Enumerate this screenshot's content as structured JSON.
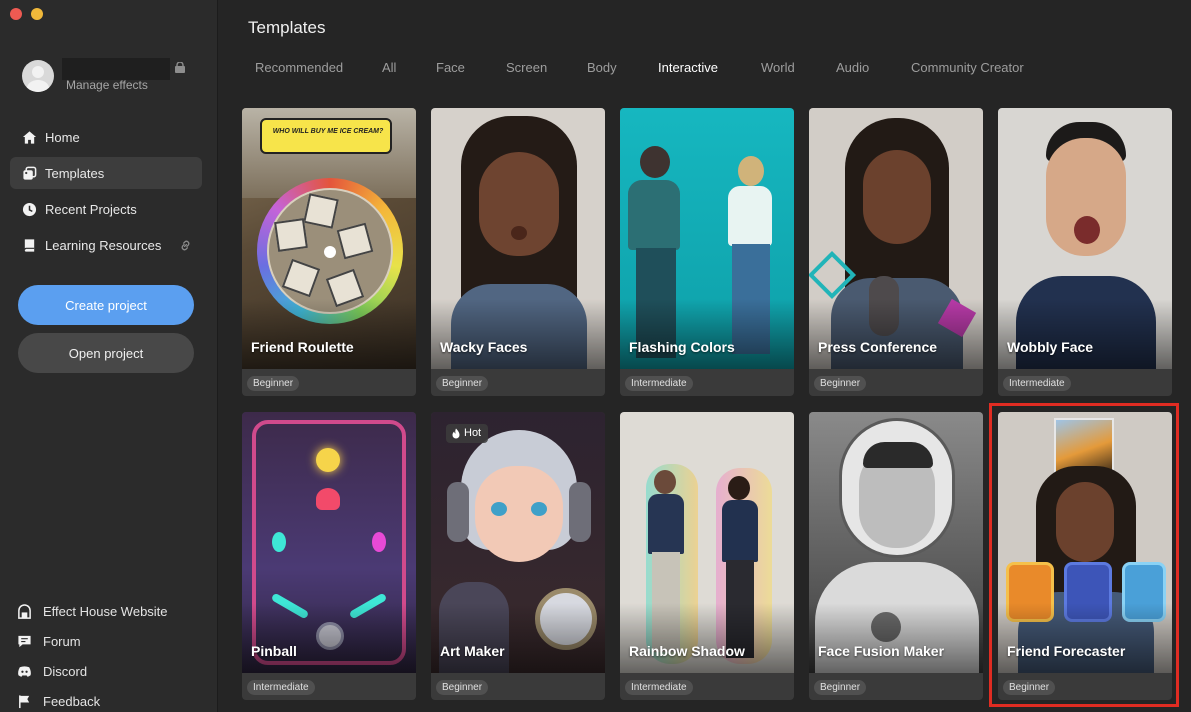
{
  "window": {
    "controls": [
      "close",
      "minimize"
    ]
  },
  "sidebar": {
    "profile": {
      "manage_label": "Manage effects"
    },
    "nav": [
      {
        "label": "Home",
        "icon": "home-icon",
        "active": false
      },
      {
        "label": "Templates",
        "icon": "templates-icon",
        "active": true
      },
      {
        "label": "Recent Projects",
        "icon": "clock-icon",
        "active": false
      },
      {
        "label": "Learning Resources",
        "icon": "book-icon",
        "active": false,
        "external": "link-icon"
      }
    ],
    "create_label": "Create project",
    "open_label": "Open project",
    "bottom_links": [
      {
        "label": "Effect House Website",
        "icon": "house-icon"
      },
      {
        "label": "Forum",
        "icon": "forum-icon"
      },
      {
        "label": "Discord",
        "icon": "discord-icon"
      },
      {
        "label": "Feedback",
        "icon": "flag-icon"
      }
    ]
  },
  "main": {
    "title": "Templates",
    "tabs": [
      "Recommended",
      "All",
      "Face",
      "Screen",
      "Body",
      "Interactive",
      "World",
      "Audio",
      "Community Creator"
    ],
    "active_tab": "Interactive",
    "cards": [
      {
        "title": "Friend Roulette",
        "level": "Beginner",
        "bubble": "WHO WILL BUY ME ICE CREAM?"
      },
      {
        "title": "Wacky Faces",
        "level": "Beginner"
      },
      {
        "title": "Flashing Colors",
        "level": "Intermediate"
      },
      {
        "title": "Press Conference",
        "level": "Beginner"
      },
      {
        "title": "Wobbly Face",
        "level": "Intermediate"
      },
      {
        "title": "Pinball",
        "level": "Intermediate"
      },
      {
        "title": "Art Maker",
        "level": "Beginner",
        "badge": "Hot"
      },
      {
        "title": "Rainbow Shadow",
        "level": "Intermediate"
      },
      {
        "title": "Face Fusion Maker",
        "level": "Beginner"
      },
      {
        "title": "Friend Forecaster",
        "level": "Beginner",
        "selected": true
      }
    ]
  },
  "colors": {
    "accent": "#5b9ff0",
    "selection": "#e02c22",
    "sidebar_bg": "#2b2b2b",
    "main_bg": "#252525"
  }
}
